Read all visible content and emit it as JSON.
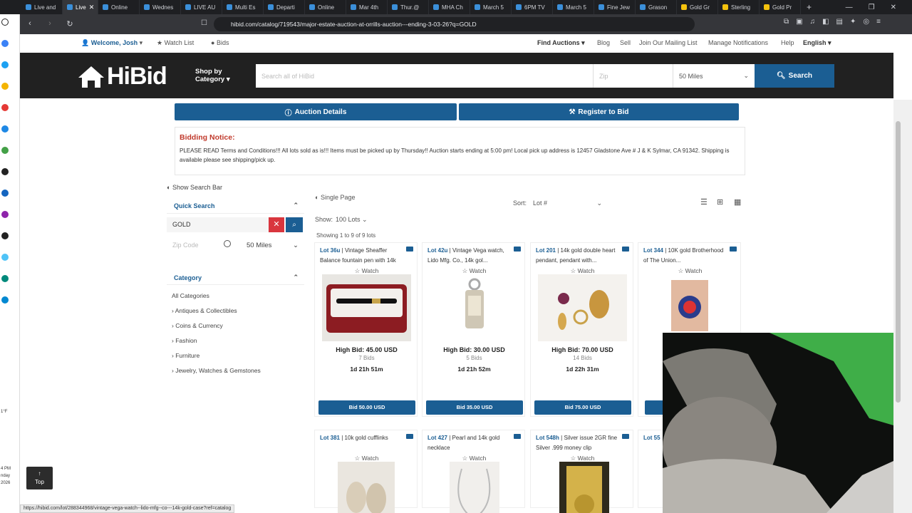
{
  "browser": {
    "tabs": [
      "Live and",
      "Live",
      "Online",
      "Wednes",
      "LIVE AU",
      "Multi Es",
      "Departi",
      "Online",
      "Mar 4th",
      "Thur.@",
      "MHA Ch",
      "March 5",
      "6PM TV",
      "March 5",
      "Fine Jew",
      "Grason",
      "Gold Gr",
      "Sterling",
      "Gold Pr"
    ],
    "url": "hibid.com/catalog/719543/major-estate-auction-at-orrills-auction---ending-3-03-26?q=GOLD",
    "status_url": "https://hibid.com/lot/288344968/vintage-vega-watch--lido-mfg--co---14k-gold-case?ref=catalog"
  },
  "left_strip": {
    "temp": "1°F",
    "time": "4 PM",
    "day": "nday",
    "year": "2026"
  },
  "topnav": {
    "welcome": "Welcome, Josh",
    "watch_list": "Watch List",
    "bids": "Bids",
    "find_auctions": "Find Auctions",
    "blog": "Blog",
    "sell": "Sell",
    "mailing": "Join Our Mailing List",
    "notifications": "Manage Notifications",
    "help": "Help",
    "language": "English"
  },
  "header": {
    "logo": "HiBid",
    "shop1": "Shop by",
    "shop2": "Category",
    "search_placeholder": "Search all of HiBid",
    "zip_placeholder": "Zip",
    "miles": "50 Miles",
    "search_btn": "Search"
  },
  "actions": {
    "auction_details": "Auction Details",
    "register": "Register to Bid"
  },
  "notice": {
    "title": "Bidding Notice:",
    "text": "PLEASE READ Terms and Conditions!!! All lots sold as is!!! Items must be picked up by Thursday!! Auction starts ending at 5:00 pm! Local pick up address is 12457 Gladstone Ave # J & K Sylmar, CA 91342. Shipping is available please see shipping/pick up."
  },
  "sidebar": {
    "show_search": "Show Search Bar",
    "quick_search": "Quick Search",
    "query": "GOLD",
    "zip_placeholder": "Zip Code",
    "miles": "50 Miles",
    "category": "Category",
    "categories": [
      "All Categories",
      "Antiques & Collectibles",
      "Coins & Currency",
      "Fashion",
      "Furniture",
      "Jewelry, Watches & Gemstones"
    ]
  },
  "listing": {
    "single_page": "Single Page",
    "sort_label": "Sort:",
    "sort_value": "Lot #",
    "show_label": "Show:",
    "show_value": "100 Lots",
    "showing": "Showing 1 to 9 of 9 lots",
    "watch": "Watch"
  },
  "lots": [
    {
      "lot": "Lot 36u",
      "title": "Vintage Sheaffer Balance fountain pen with 14k",
      "high": "High Bid: 45.00 USD",
      "bids": "7 Bids",
      "time": "1d 21h 51m",
      "bid": "Bid 50.00 USD"
    },
    {
      "lot": "Lot 42u",
      "title": "Vintage Vega watch, Lido Mfg. Co., 14k gol...",
      "high": "High Bid: 30.00 USD",
      "bids": "5 Bids",
      "time": "1d 21h 52m",
      "bid": "Bid 35.00 USD"
    },
    {
      "lot": "Lot 201",
      "title": "14k gold double heart pendant, pendant with...",
      "high": "High Bid: 70.00 USD",
      "bids": "14 Bids",
      "time": "1d 22h 31m",
      "bid": "Bid 75.00 USD"
    },
    {
      "lot": "Lot 344",
      "title": "10K gold Brotherhood of The Union...",
      "high": "",
      "bids": "",
      "time": "",
      "bid": ""
    },
    {
      "lot": "Lot 381",
      "title": "10k gold cufflinks"
    },
    {
      "lot": "Lot 427",
      "title": "Pearl and 14k gold necklace"
    },
    {
      "lot": "Lot 548h",
      "title": "Silver issue 2GR fine Silver .999 money clip"
    },
    {
      "lot": "Lot 55",
      "title": ""
    }
  ],
  "top_btn": "Top"
}
